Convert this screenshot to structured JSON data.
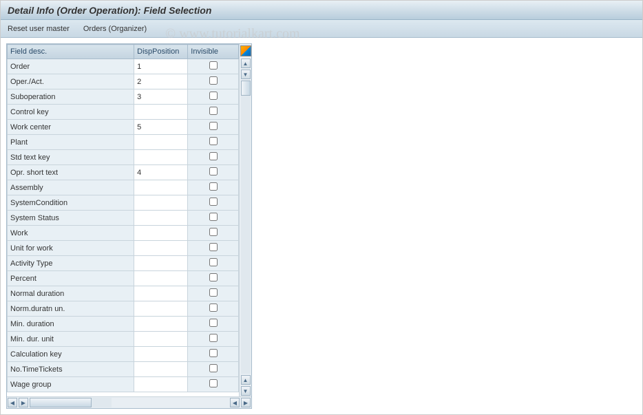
{
  "title": "Detail Info (Order Operation): Field Selection",
  "toolbar": {
    "reset_user_master": "Reset user master",
    "orders_organizer": "Orders (Organizer)"
  },
  "table": {
    "headers": {
      "field_desc": "Field desc.",
      "disp_position": "DispPosition",
      "invisible": "Invisible"
    },
    "rows": [
      {
        "desc": "Order",
        "pos": "1",
        "inv": false
      },
      {
        "desc": "Oper./Act.",
        "pos": "2",
        "inv": false
      },
      {
        "desc": "Suboperation",
        "pos": "3",
        "inv": false
      },
      {
        "desc": "Control key",
        "pos": "",
        "inv": false
      },
      {
        "desc": "Work center",
        "pos": "5",
        "inv": false
      },
      {
        "desc": "Plant",
        "pos": "",
        "inv": false
      },
      {
        "desc": "Std text key",
        "pos": "",
        "inv": false
      },
      {
        "desc": "Opr. short text",
        "pos": "4",
        "inv": false
      },
      {
        "desc": "Assembly",
        "pos": "",
        "inv": false
      },
      {
        "desc": "SystemCondition",
        "pos": "",
        "inv": false
      },
      {
        "desc": "System Status",
        "pos": "",
        "inv": false
      },
      {
        "desc": "Work",
        "pos": "",
        "inv": false
      },
      {
        "desc": "Unit for work",
        "pos": "",
        "inv": false
      },
      {
        "desc": "Activity Type",
        "pos": "",
        "inv": false
      },
      {
        "desc": "Percent",
        "pos": "",
        "inv": false
      },
      {
        "desc": "Normal duration",
        "pos": "",
        "inv": false
      },
      {
        "desc": "Norm.duratn un.",
        "pos": "",
        "inv": false
      },
      {
        "desc": "Min. duration",
        "pos": "",
        "inv": false
      },
      {
        "desc": "Min. dur. unit",
        "pos": "",
        "inv": false
      },
      {
        "desc": "Calculation key",
        "pos": "",
        "inv": false
      },
      {
        "desc": "No.TimeTickets",
        "pos": "",
        "inv": false
      },
      {
        "desc": "Wage group",
        "pos": "",
        "inv": false
      }
    ]
  },
  "watermark": "© www.tutorialkart.com"
}
